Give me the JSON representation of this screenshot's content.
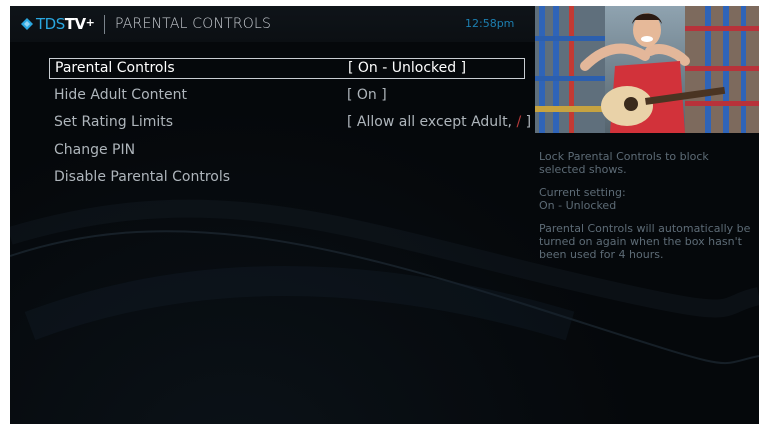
{
  "header": {
    "brand_tds": "TDS",
    "brand_tv": "TV",
    "brand_plus": "+",
    "title": "PARENTAL CONTROLS",
    "time": "12:58pm"
  },
  "menu": {
    "items": [
      {
        "label": "Parental Controls",
        "value": "[ On - Unlocked ]",
        "selected": true
      },
      {
        "label": "Hide Adult Content",
        "value": "[ On ]",
        "selected": false
      },
      {
        "label": "Set Rating Limits",
        "value_main": "[ Allow all except Adult, ",
        "value_slash": "/",
        "value_end": " ]",
        "selected": false
      },
      {
        "label": "Change PIN",
        "value": "",
        "selected": false
      },
      {
        "label": "Disable Parental Controls",
        "value": "",
        "selected": false
      }
    ]
  },
  "info": {
    "description": "Lock Parental Controls to block selected shows.",
    "current_label": "Current setting:",
    "current_value": "On - Unlocked",
    "note": "Parental Controls will automatically be turned on again when the box hasn't been used for 4 hours."
  },
  "colors": {
    "brand_blue": "#2aa7e0",
    "clock_blue": "#1c7fb0",
    "selection_border": "#c8cdd2",
    "info_text": "#5d6b76"
  },
  "icons": [
    "tds-logo-icon"
  ]
}
